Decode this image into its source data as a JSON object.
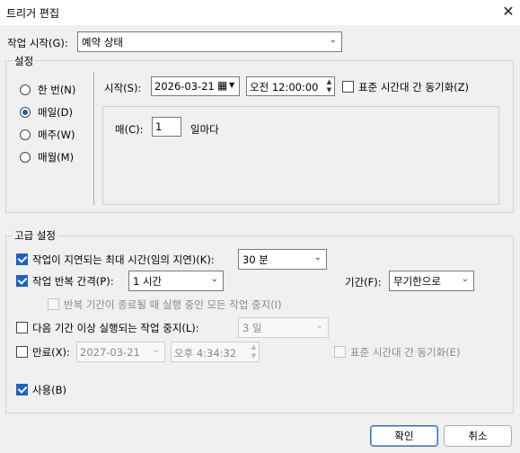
{
  "window": {
    "title": "트리거 편집",
    "close_icon": "close-icon"
  },
  "start_task": {
    "label": "작업 시작(G):",
    "value": "예약 상태"
  },
  "settings": {
    "legend": "설정",
    "frequency": [
      {
        "label": "한 번(N)",
        "selected": false
      },
      {
        "label": "매일(D)",
        "selected": true
      },
      {
        "label": "매주(W)",
        "selected": false
      },
      {
        "label": "매월(M)",
        "selected": false
      }
    ],
    "start_label": "시작(S):",
    "start_date": "2026-03-21",
    "start_time": "오전 12:00:00",
    "sync_tz_label": "표준 시간대 간 동기화(Z)",
    "sync_tz_checked": false,
    "every_label": "매(C):",
    "every_value": "1",
    "every_suffix": "일마다"
  },
  "advanced": {
    "legend": "고급 설정",
    "delay": {
      "label": "작업이 지연되는 최대 시간(임의 지연)(K):",
      "checked": true,
      "value": "30 분"
    },
    "repeat": {
      "label": "작업 반복 간격(P):",
      "checked": true,
      "value": "1 시간"
    },
    "duration": {
      "label": "기간(F):",
      "value": "무기한으로"
    },
    "stop_all": {
      "label": "반복 기간이 종료될 때 실행 중인 모든 작업 중지(I)",
      "checked": false
    },
    "stop_longer": {
      "label": "다음 기간 이상 실행되는 작업 중지(L):",
      "checked": false,
      "value": "3 일"
    },
    "expire": {
      "label": "만료(X):",
      "checked": false,
      "date": "2027-03-21",
      "time": "오후   4:34:32",
      "sync_label": "표준 시간대 간 동기화(E)"
    },
    "enabled": {
      "label": "사용(B)",
      "checked": true
    }
  },
  "buttons": {
    "ok": "확인",
    "cancel": "취소"
  },
  "colors": {
    "accent": "#1a62c7"
  }
}
